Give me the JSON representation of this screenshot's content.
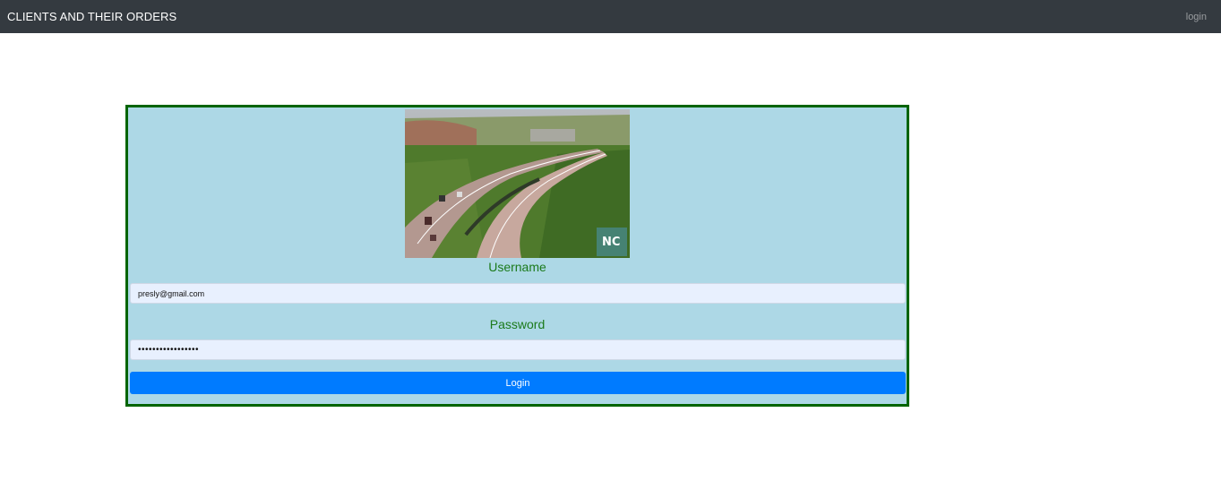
{
  "navbar": {
    "brand": "CLIENTS AND THEIR ORDERS",
    "login_link": "login",
    "background": "#343a40"
  },
  "form": {
    "border_color": "#006400",
    "background": "#add8e6",
    "image_alt": "highway",
    "username_label": "Username",
    "username_value": "presly@gmail.com",
    "password_label": "Password",
    "password_value": "presly12345678901",
    "submit_label": "Login",
    "submit_color": "#007bff"
  }
}
